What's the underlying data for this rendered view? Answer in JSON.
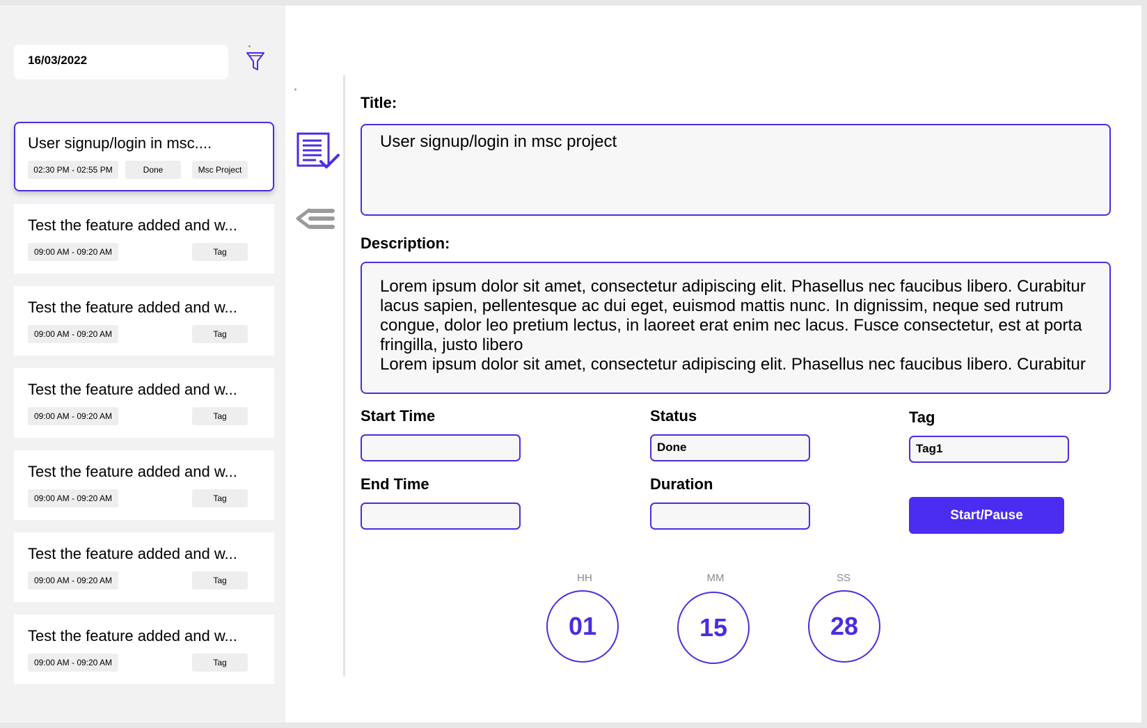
{
  "sidebar": {
    "date_value": "16/03/2022",
    "filter_icon": "funnel-icon",
    "tasks": [
      {
        "title": "User signup/login in msc....",
        "time": "02:30 PM - 02:55 PM",
        "status": "Done",
        "tag": "Msc Project"
      },
      {
        "title": "Test the feature added and w...",
        "time": "09:00 AM - 09:20 AM",
        "status": "",
        "tag": "Tag"
      },
      {
        "title": "Test the feature added and w...",
        "time": "09:00 AM - 09:20 AM",
        "status": "",
        "tag": "Tag"
      },
      {
        "title": "Test the feature added and w...",
        "time": "09:00 AM - 09:20 AM",
        "status": "",
        "tag": "Tag"
      },
      {
        "title": "Test the feature added and w...",
        "time": "09:00 AM - 09:20 AM",
        "status": "",
        "tag": "Tag"
      },
      {
        "title": "Test the feature added and w...",
        "time": "09:00 AM - 09:20 AM",
        "status": "",
        "tag": "Tag"
      },
      {
        "title": "Test the feature added and w...",
        "time": "09:00 AM - 09:20 AM",
        "status": "",
        "tag": "Tag"
      }
    ]
  },
  "toolbar": {
    "task_list_icon": "checklist-icon",
    "back_icon": "collapse-list-icon"
  },
  "form": {
    "title_label": "Title:",
    "title_value": "User signup/login in msc project",
    "description_label": "Description:",
    "description_value": "Lorem ipsum dolor sit amet, consectetur adipiscing elit. Phasellus nec faucibus libero. Curabitur lacus sapien, pellentesque ac dui eget, euismod mattis nunc. In dignissim, neque sed rutrum congue, dolor leo pretium lectus, in laoreet erat enim nec lacus. Fusce consectetur, est at porta fringilla, justo libero\nLorem ipsum dolor sit amet, consectetur adipiscing elit. Phasellus nec faucibus libero. Curabitur",
    "start_time_label": "Start Time",
    "start_time_value": "",
    "end_time_label": "End Time",
    "end_time_value": "",
    "status_label": "Status",
    "status_value": "Done",
    "duration_label": "Duration",
    "duration_value": "",
    "tag_label": "Tag",
    "tag_value": "Tag1",
    "start_pause_label": "Start/Pause"
  },
  "timer": {
    "hh_label": "HH",
    "hh_value": "01",
    "mm_label": "MM",
    "mm_value": "15",
    "ss_label": "SS",
    "ss_value": "28"
  },
  "colors": {
    "accent": "#4a2de0",
    "button": "#4a2df0",
    "sidebar_bg": "#f2f2f2"
  }
}
